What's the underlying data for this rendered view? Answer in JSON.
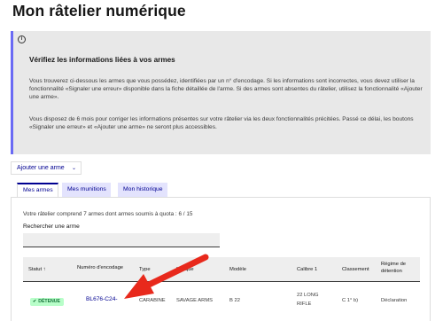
{
  "page": {
    "title": "Mon râtelier numérique"
  },
  "notice": {
    "icon": "info-icon",
    "heading": "Vérifiez les informations liées à vos armes",
    "paragraph_1": "Vous trouverez ci-dessous les armes que vous possédez, identifiées par un n° d'encodage. Si les informations sont incorrectes, vous devez utiliser la fonctionnalité «Signaler une erreur» disponible dans la fiche détaillée de l'arme. Si des armes sont absentes du râtelier, utilisez la fonctionnalité «Ajouter une arme».",
    "paragraph_2": "Vous disposez de 6 mois pour corriger les informations présentes sur votre râtelier via les deux fonctionnalités précitées. Passé ce délai, les boutons «Signaler une erreur» et «Ajouter une arme» ne seront plus accessibles."
  },
  "actions": {
    "add_weapon_label": "Ajouter une arme"
  },
  "tabs": [
    {
      "label": "Mes armes",
      "active": true
    },
    {
      "label": "Mes munitions",
      "active": false
    },
    {
      "label": "Mon historique",
      "active": false
    }
  ],
  "armes": {
    "summary": "Votre râtelier comprend 7 armes dont armes soumis à quota : 6 / 15",
    "search_label": "Rechercher une arme",
    "search_value": "",
    "columns": {
      "statut": "Statut ↑",
      "numero": "Numéro d'encodage",
      "type": "Type",
      "marque": "Marque",
      "modele": "Modèle",
      "calibre": "Calibre 1",
      "classement": "Classement",
      "regime_line1": "Régime de",
      "regime_line2": "détention"
    },
    "rows": [
      {
        "statut": "DÉTENUE",
        "numero": "BL676-C24-",
        "type": "CARABINE",
        "marque": "SAVAGE ARMS",
        "modele": "B 22",
        "calibre_line1": "22 LONG",
        "calibre_line2": "RIFLE",
        "classement": "C 1° b)",
        "regime": "Déclaration"
      }
    ]
  },
  "colors": {
    "accent": "#000091",
    "badge_bg": "#b8fec9",
    "badge_text": "#18753c",
    "annotation_arrow": "#e8291c"
  }
}
